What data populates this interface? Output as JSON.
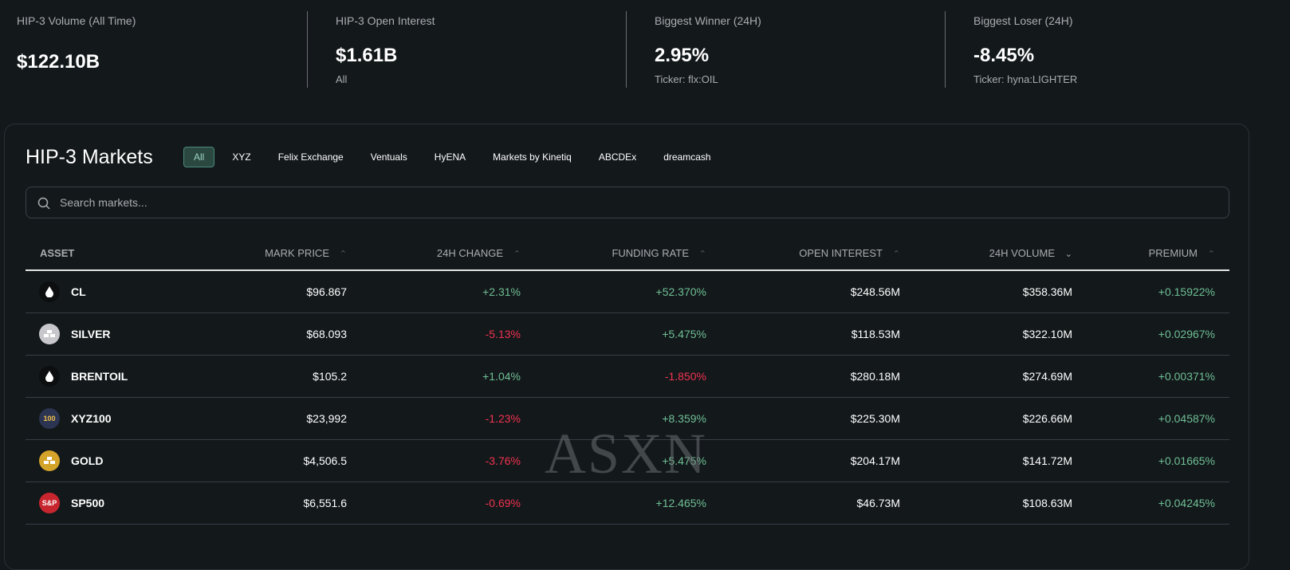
{
  "stats": [
    {
      "label": "HIP-3 Volume (All Time)",
      "value": "$122.10B",
      "sub": ""
    },
    {
      "label": "HIP-3 Open Interest",
      "value": "$1.61B",
      "sub": "All"
    },
    {
      "label": "Biggest Winner (24H)",
      "value": "2.95%",
      "sub": "Ticker: flx:OIL"
    },
    {
      "label": "Biggest Loser (24H)",
      "value": "-8.45%",
      "sub": "Ticker: hyna:LIGHTER"
    }
  ],
  "markets": {
    "title": "HIP-3 Markets",
    "tabs": [
      "All",
      "XYZ",
      "Felix Exchange",
      "Ventuals",
      "HyENA",
      "Markets by Kinetiq",
      "ABCDEx",
      "dreamcash"
    ],
    "search_placeholder": "Search markets...",
    "columns": [
      "ASSET",
      "MARK PRICE",
      "24H CHANGE",
      "FUNDING RATE",
      "OPEN INTEREST",
      "24H VOLUME",
      "PREMIUM"
    ],
    "sort_arrows": [
      "^",
      "^",
      "^",
      "^",
      "v",
      "^"
    ],
    "rows": [
      {
        "asset": "CL",
        "icon": "oil-drop",
        "price": "$96.867",
        "change": "+2.31%",
        "funding": "+52.370%",
        "oi": "$248.56M",
        "volume": "$358.36M",
        "premium": "+0.15922%"
      },
      {
        "asset": "SILVER",
        "icon": "silver-bars",
        "price": "$68.093",
        "change": "-5.13%",
        "funding": "+5.475%",
        "oi": "$118.53M",
        "volume": "$322.10M",
        "premium": "+0.02967%"
      },
      {
        "asset": "BRENTOIL",
        "icon": "oil-drop",
        "price": "$105.2",
        "change": "+1.04%",
        "funding": "-1.850%",
        "oi": "$280.18M",
        "volume": "$274.69M",
        "premium": "+0.00371%"
      },
      {
        "asset": "XYZ100",
        "icon": "100",
        "price": "$23,992",
        "change": "-1.23%",
        "funding": "+8.359%",
        "oi": "$225.30M",
        "volume": "$226.66M",
        "premium": "+0.04587%"
      },
      {
        "asset": "GOLD",
        "icon": "gold-bars",
        "price": "$4,506.5",
        "change": "-3.76%",
        "funding": "+5.475%",
        "oi": "$204.17M",
        "volume": "$141.72M",
        "premium": "+0.01665%"
      },
      {
        "asset": "SP500",
        "icon": "S&P",
        "price": "$6,551.6",
        "change": "-0.69%",
        "funding": "+12.465%",
        "oi": "$46.73M",
        "volume": "$108.63M",
        "premium": "+0.04245%"
      }
    ]
  },
  "watermark": "ASXN"
}
